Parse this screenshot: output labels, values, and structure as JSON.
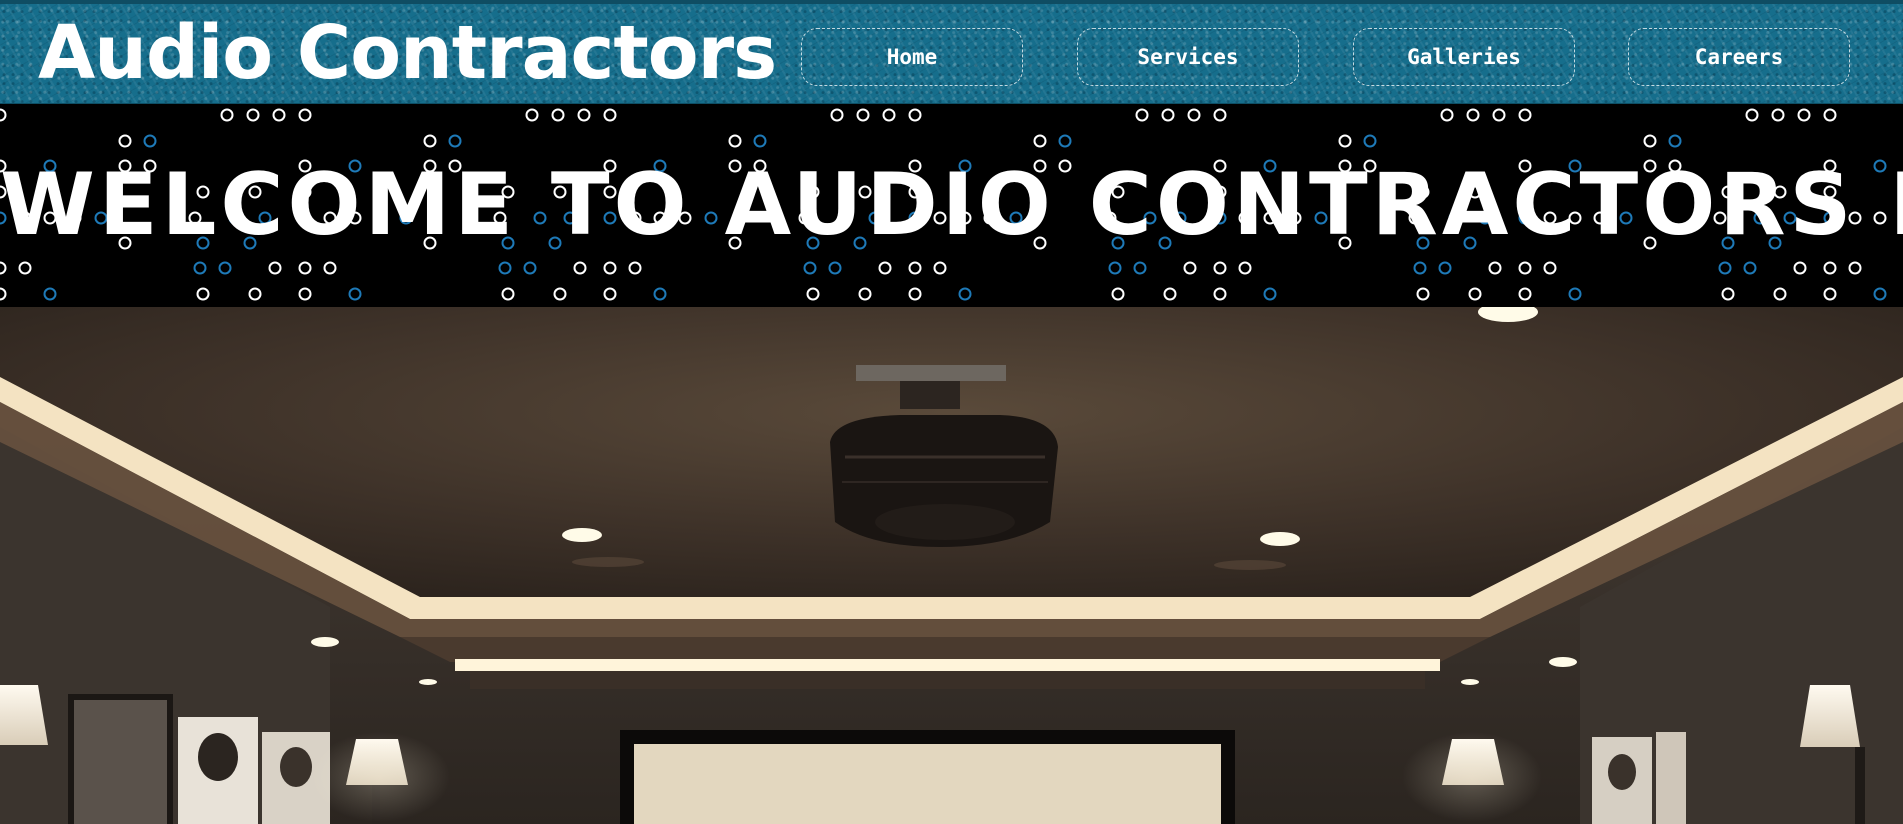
{
  "header": {
    "logo_text": "Audio Contractors",
    "nav": [
      {
        "label": "Home"
      },
      {
        "label": "Services"
      },
      {
        "label": "Galleries"
      },
      {
        "label": "Careers"
      }
    ]
  },
  "banner": {
    "heading": "WELCOME TO AUDIO CONTRACTORS LLC."
  },
  "colors": {
    "header_teal": "#166e8c",
    "banner_black": "#000000",
    "dot_white": "#ffffff",
    "dot_blue": "#1e7ab8"
  },
  "icons": [
    "hero-photo-home-theater"
  ]
}
